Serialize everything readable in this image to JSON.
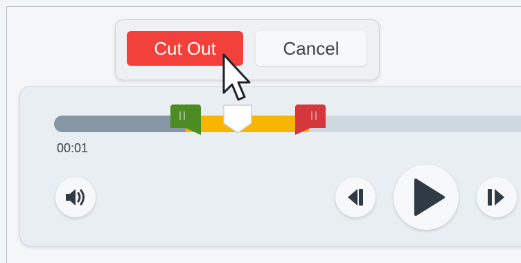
{
  "popup": {
    "cut_out_label": "Cut Out",
    "cancel_label": "Cancel"
  },
  "timeline": {
    "timecode": "00:01",
    "played_fraction": 0.27,
    "selection_start_fraction": 0.27,
    "selection_end_fraction": 0.52
  },
  "controls": {
    "volume_icon": "volume-icon",
    "previous_icon": "step-back-icon",
    "play_icon": "play-icon",
    "next_icon": "step-forward-icon"
  },
  "colors": {
    "cut_out": "#f2413a",
    "selection": "#f7b500",
    "start_handle": "#4c8c22",
    "end_handle": "#d6373b",
    "played": "#8696a2",
    "track": "#d0d8df"
  }
}
